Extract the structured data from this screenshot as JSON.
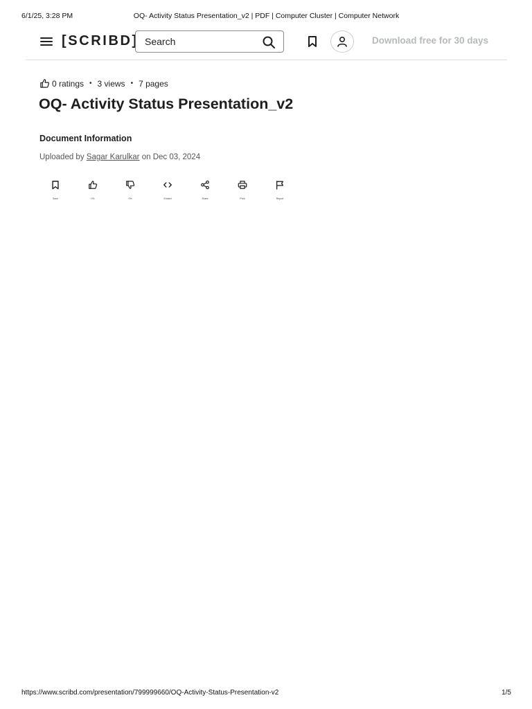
{
  "print": {
    "datetime": "6/1/25, 3:28 PM",
    "page_title": "OQ- Activity Status Presentation_v2 | PDF | Computer Cluster | Computer Network",
    "url": "https://www.scribd.com/presentation/799999660/OQ-Activity-Status-Presentation-v2",
    "page_number": "1/5"
  },
  "header": {
    "logo": "[SCRIBD]",
    "search_placeholder": "Search",
    "download_label": "Download free for 30 days"
  },
  "document": {
    "ratings": "0 ratings",
    "views": "3 views",
    "pages": "7 pages",
    "title": "OQ- Activity Status Presentation_v2",
    "info_heading": "Document Information",
    "uploaded_prefix": "Uploaded by",
    "author": "Sagar Karulkar",
    "uploaded_suffix": "on Dec 03, 2024"
  },
  "actions": [
    {
      "label": "Save",
      "icon": "bookmark-icon"
    },
    {
      "label": "0%",
      "icon": "thumbs-up-icon"
    },
    {
      "label": "0%",
      "icon": "thumbs-down-icon"
    },
    {
      "label": "Embed",
      "icon": "code-icon"
    },
    {
      "label": "Share",
      "icon": "share-icon"
    },
    {
      "label": "Print",
      "icon": "printer-icon"
    },
    {
      "label": "Report",
      "icon": "flag-icon"
    }
  ],
  "colors": {
    "text": "#1e1e1e",
    "muted": "#555555",
    "download_link": "#b7b9bc",
    "divider": "#dedede"
  }
}
